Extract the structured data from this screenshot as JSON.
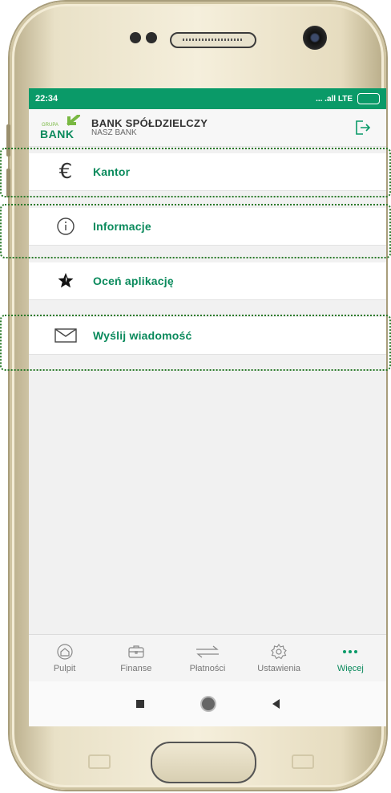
{
  "status_bar": {
    "time": "22:34",
    "signal": "... .all LTE",
    "battery": ""
  },
  "header": {
    "logo_small": "GRUPA",
    "logo_word": "BANK",
    "bank_name": "BANK SPÓŁDZIELCZY",
    "bank_sub": "NASZ BANK"
  },
  "menu": [
    {
      "label": "Kantor",
      "icon": "euro-icon"
    },
    {
      "label": "Informacje",
      "icon": "info-icon"
    },
    {
      "label": "Oceń aplikację",
      "icon": "star-icon"
    },
    {
      "label": "Wyślij wiadomość",
      "icon": "envelope-icon"
    }
  ],
  "bottom_nav": [
    {
      "label": "Pulpit",
      "icon": "home-icon"
    },
    {
      "label": "Finanse",
      "icon": "wallet-icon"
    },
    {
      "label": "Płatności",
      "icon": "transfer-icon"
    },
    {
      "label": "Ustawienia",
      "icon": "gear-icon"
    },
    {
      "label": "Więcej",
      "icon": "more-dots-icon",
      "active": true
    }
  ],
  "colors": {
    "accent": "#0a9a68",
    "accent_text": "#0a8a5c",
    "highlight": "#2a7a2a"
  }
}
